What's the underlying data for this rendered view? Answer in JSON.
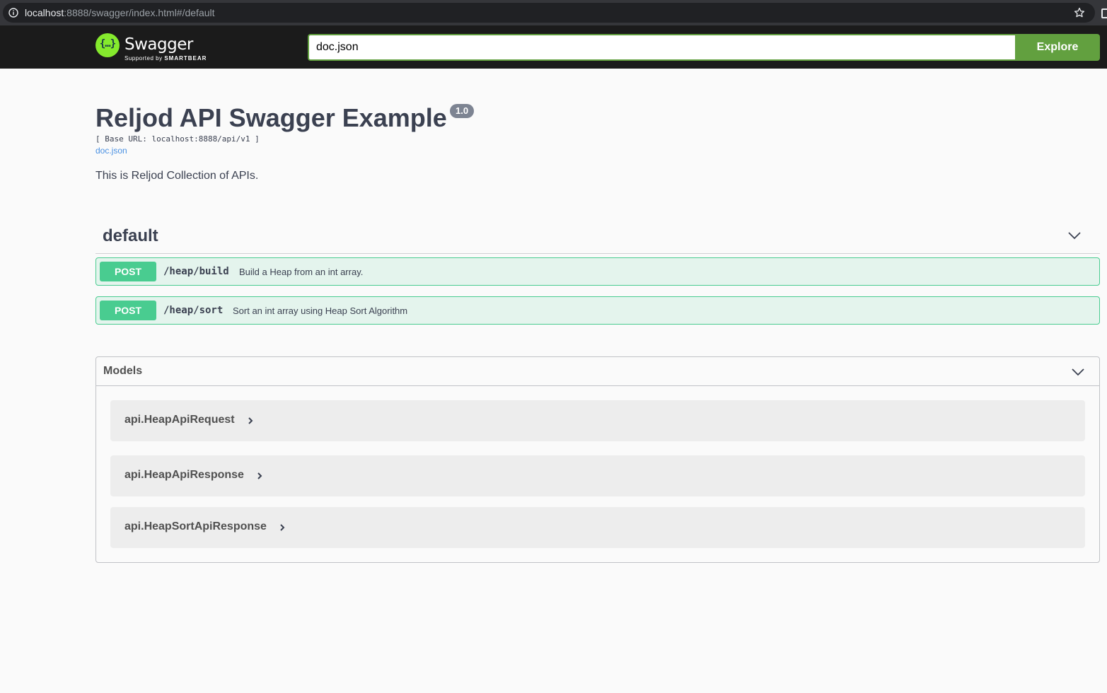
{
  "browser": {
    "url_host": "localhost",
    "url_rest": ":8888/swagger/index.html#/default"
  },
  "topbar": {
    "logo_symbol": "{…}",
    "logo_title": "Swagger",
    "logo_supported": "Supported by",
    "logo_brand": "SMARTBEAR",
    "spec_url_value": "doc.json",
    "explore_label": "Explore",
    "accent": "#62a03f"
  },
  "info": {
    "title": "Reljod API Swagger Example",
    "version": "1.0",
    "base_url": "[ Base URL: localhost:8888/api/v1 ]",
    "spec_link": "doc.json",
    "description": "This is Reljod Collection of APIs."
  },
  "tag": {
    "name": "default",
    "operations": [
      {
        "method": "POST",
        "path": "/heap/build",
        "summary": "Build a Heap from an int array."
      },
      {
        "method": "POST",
        "path": "/heap/sort",
        "summary": "Sort an int array using Heap Sort Algorithm"
      }
    ],
    "post_color": "#49cc90"
  },
  "models": {
    "title": "Models",
    "items": [
      {
        "name": "api.HeapApiRequest"
      },
      {
        "name": "api.HeapApiResponse"
      },
      {
        "name": "api.HeapSortApiResponse"
      }
    ]
  },
  "icons": [
    "info-icon",
    "star-icon",
    "swagger-logo-icon",
    "chevron-down-icon",
    "chevron-right-icon"
  ]
}
